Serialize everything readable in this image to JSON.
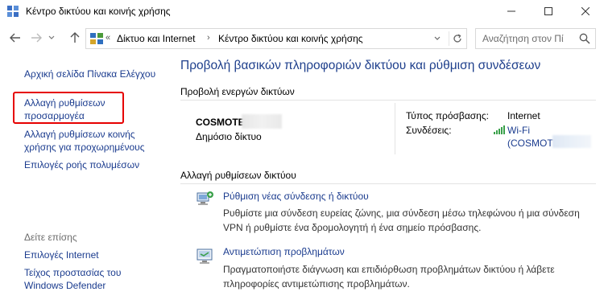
{
  "window": {
    "title": "Κέντρο δικτύου και κοινής χρήσης",
    "minimize": "—",
    "maximize": "☐",
    "close": "✕"
  },
  "nav": {
    "back": "←",
    "forward": "→",
    "recent": "⌄",
    "up": "↑",
    "address": {
      "chevron_root": "«",
      "crumbs": [
        "Δίκτυο και Internet",
        "Κέντρο δικτύου και κοινής χρήσης"
      ],
      "separator": "›",
      "dropdown": "⌄",
      "refresh": "↻"
    },
    "search": {
      "placeholder": "Αναζήτηση στον Πί"
    }
  },
  "sidebar": {
    "links": [
      "Αρχική σελίδα Πίνακα Ελέγχου",
      "Αλλαγή ρυθμίσεων",
      "προσαρμογέα",
      "Αλλαγή ρυθμίσεων κοινής",
      "χρήσης για προχωρημένους",
      "Επιλογές ροής πολυμέσων"
    ],
    "see_also": "Δείτε επίσης",
    "see_also_links": [
      "Επιλογές Internet",
      "Τείχος προστασίας του",
      "Windows Defender"
    ],
    "highlight_color": "#e60000"
  },
  "main": {
    "title": "Προβολή βασικών πληροφοριών δικτύου και ρύθμιση συνδέσεων",
    "active_header": "Προβολή ενεργών δικτύων",
    "network": {
      "name": "COSMOTE",
      "category": "Δημόσιο δίκτυο",
      "access_label": "Τύπος πρόσβασης:",
      "access_value": "Internet",
      "connections_label": "Συνδέσεις:",
      "connection_line1": "Wi-Fi",
      "connection_line2": "(COSMOTE"
    },
    "change_header": "Αλλαγή ρυθμίσεων δικτύου",
    "tasks": [
      {
        "title": "Ρύθμιση νέας σύνδεσης ή δικτύου",
        "desc1": "Ρυθμίστε μια σύνδεση ευρείας ζώνης, μια σύνδεση μέσω τηλεφώνου ή μια σύνδεση",
        "desc2": "VPN ή ρυθμίστε ένα δρομολογητή ή ένα σημείο πρόσβασης."
      },
      {
        "title": "Αντιμετώπιση προβλημάτων",
        "desc1": "Πραγματοποιήστε διάγνωση και επιδιόρθωση προβλημάτων δικτύου ή λάβετε",
        "desc2": "πληροφορίες αντιμετώπισης προβλημάτων."
      }
    ]
  },
  "colors": {
    "link": "#1a3b8e",
    "title": "#1e3f8c",
    "muted": "#6d6d6d"
  },
  "icons": [
    "control-panel-icon",
    "search-icon",
    "wifi-signal-icon",
    "new-connection-icon",
    "troubleshoot-icon",
    "refresh-icon"
  ]
}
